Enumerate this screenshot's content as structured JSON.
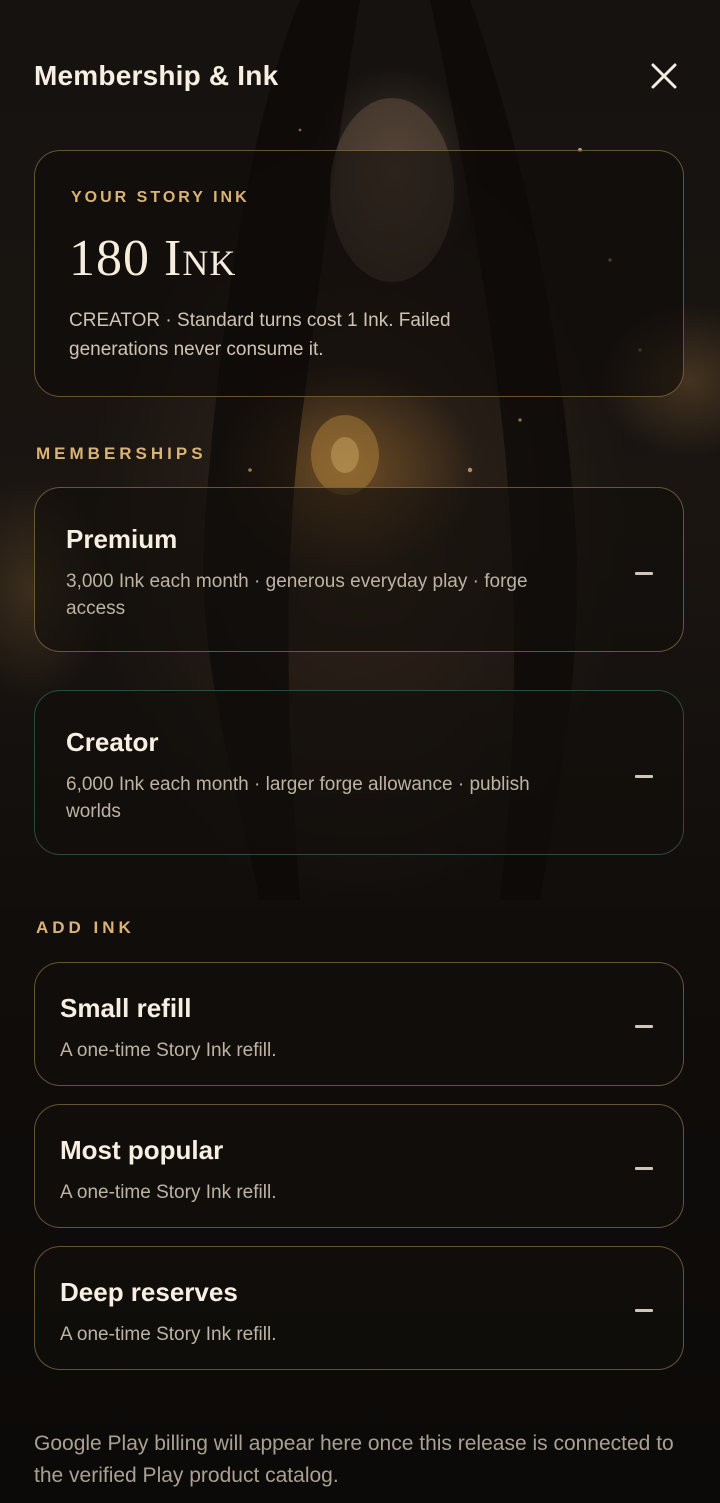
{
  "header": {
    "title": "Membership & Ink"
  },
  "ink": {
    "eyebrow": "YOUR STORY INK",
    "amount": "180 Ink",
    "note": "CREATOR · Standard turns cost 1 Ink. Failed generations never consume it."
  },
  "memberships": {
    "label": "MEMBERSHIPS",
    "plans": [
      {
        "title": "Premium",
        "description": "3,000 Ink each month · generous everyday play · forge access"
      },
      {
        "title": "Creator",
        "description": "6,000 Ink each month · larger forge allowance · publish worlds"
      }
    ]
  },
  "add_ink": {
    "label": "ADD INK",
    "refills": [
      {
        "title": "Small refill",
        "description": "A one-time Story Ink refill."
      },
      {
        "title": "Most popular",
        "description": "A one-time Story Ink refill."
      },
      {
        "title": "Deep reserves",
        "description": "A one-time Story Ink refill."
      }
    ]
  },
  "footer": {
    "note": "Google Play billing will appear here once this release is connected to the verified Play product catalog."
  },
  "icons": {
    "close": "close-icon",
    "price_placeholder": "dash-icon"
  },
  "colors": {
    "accent_gold": "#d9b476",
    "background": "#0d0b09",
    "card_border": "#b08c58",
    "creator_border": "#467878"
  }
}
